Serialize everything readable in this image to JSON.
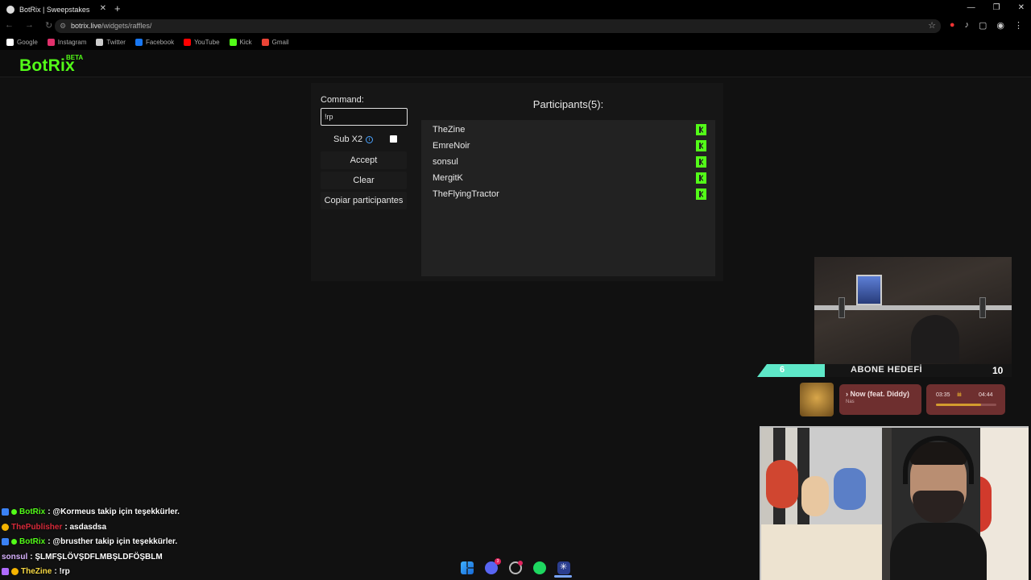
{
  "browser": {
    "tab_title": "BotRix | Sweepstakes",
    "new_tab": "+",
    "url_host": "botrix.live",
    "url_path": "/widgets/raffles/",
    "bookmarks": [
      {
        "label": "Google",
        "color": "#ffffff"
      },
      {
        "label": "Instagram",
        "color": "#e1306c"
      },
      {
        "label": "Twitter",
        "color": "#cccccc"
      },
      {
        "label": "Facebook",
        "color": "#1877f2"
      },
      {
        "label": "YouTube",
        "color": "#ff0000"
      },
      {
        "label": "Kick",
        "color": "#53fc18"
      },
      {
        "label": "Gmail",
        "color": "#ea4335"
      }
    ]
  },
  "header": {
    "logo": "BotRix",
    "beta": "BETA"
  },
  "raffle": {
    "command_label": "Command:",
    "command_value": "!rp",
    "sub_label": "Sub X2",
    "sub_checked": true,
    "accept_label": "Accept",
    "clear_label": "Clear",
    "copy_label": "Copiar participantes",
    "participants_title": "Participants(5):",
    "participants": [
      "TheZine",
      "EmreNoir",
      "sonsul",
      "MergitK",
      "TheFlyingTractor"
    ]
  },
  "overlay": {
    "goal_min": "6",
    "goal_label": "ABONE HEDEFİ",
    "goal_max": "10",
    "song_title": "› Now (feat. Diddy)",
    "song_artist": "Nas",
    "time_current": "03:35",
    "time_total": "04:44",
    "progress": 0.75
  },
  "chat": [
    {
      "user": "BotRix",
      "text": ": @Kormeus takip için teşekkürler.",
      "badges": [
        "bot",
        "verified"
      ]
    },
    {
      "user": "ThePublisher",
      "text": ": asdasdsa",
      "badges": [
        "og"
      ]
    },
    {
      "user": "BotRix",
      "text": ": @brusther takip için teşekkürler.",
      "badges": [
        "bot",
        "verified"
      ]
    },
    {
      "user": "sonsul",
      "text": ": ŞLMFŞLÖVŞDFLMBŞLDFÖŞBLM",
      "badges": []
    },
    {
      "user": "TheZine",
      "text": ": !rp",
      "badges": [
        "sub",
        "og"
      ]
    }
  ]
}
